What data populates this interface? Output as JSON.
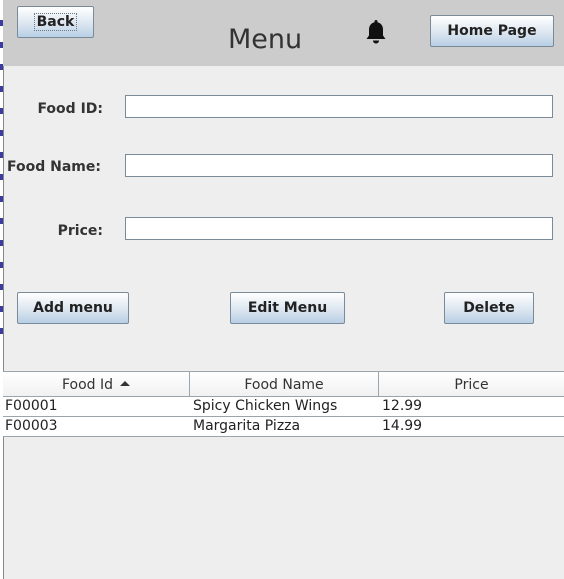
{
  "header": {
    "back_label": "Back",
    "title": "Menu",
    "home_label": "Home Page"
  },
  "form": {
    "food_id": {
      "label": "Food ID:",
      "value": ""
    },
    "food_name": {
      "label": "Food Name:",
      "value": ""
    },
    "price": {
      "label": "Price:",
      "value": ""
    }
  },
  "actions": {
    "add_label": "Add menu",
    "edit_label": "Edit Menu",
    "delete_label": "Delete"
  },
  "table": {
    "columns": [
      "Food Id",
      "Food Name",
      "Price"
    ],
    "sort_column": "Food Id",
    "sort_direction": "ascending",
    "rows": [
      [
        "F00001",
        "Spicy Chicken Wings",
        "12.99"
      ],
      [
        "F00003",
        "Margarita Pizza",
        "14.99"
      ]
    ]
  }
}
